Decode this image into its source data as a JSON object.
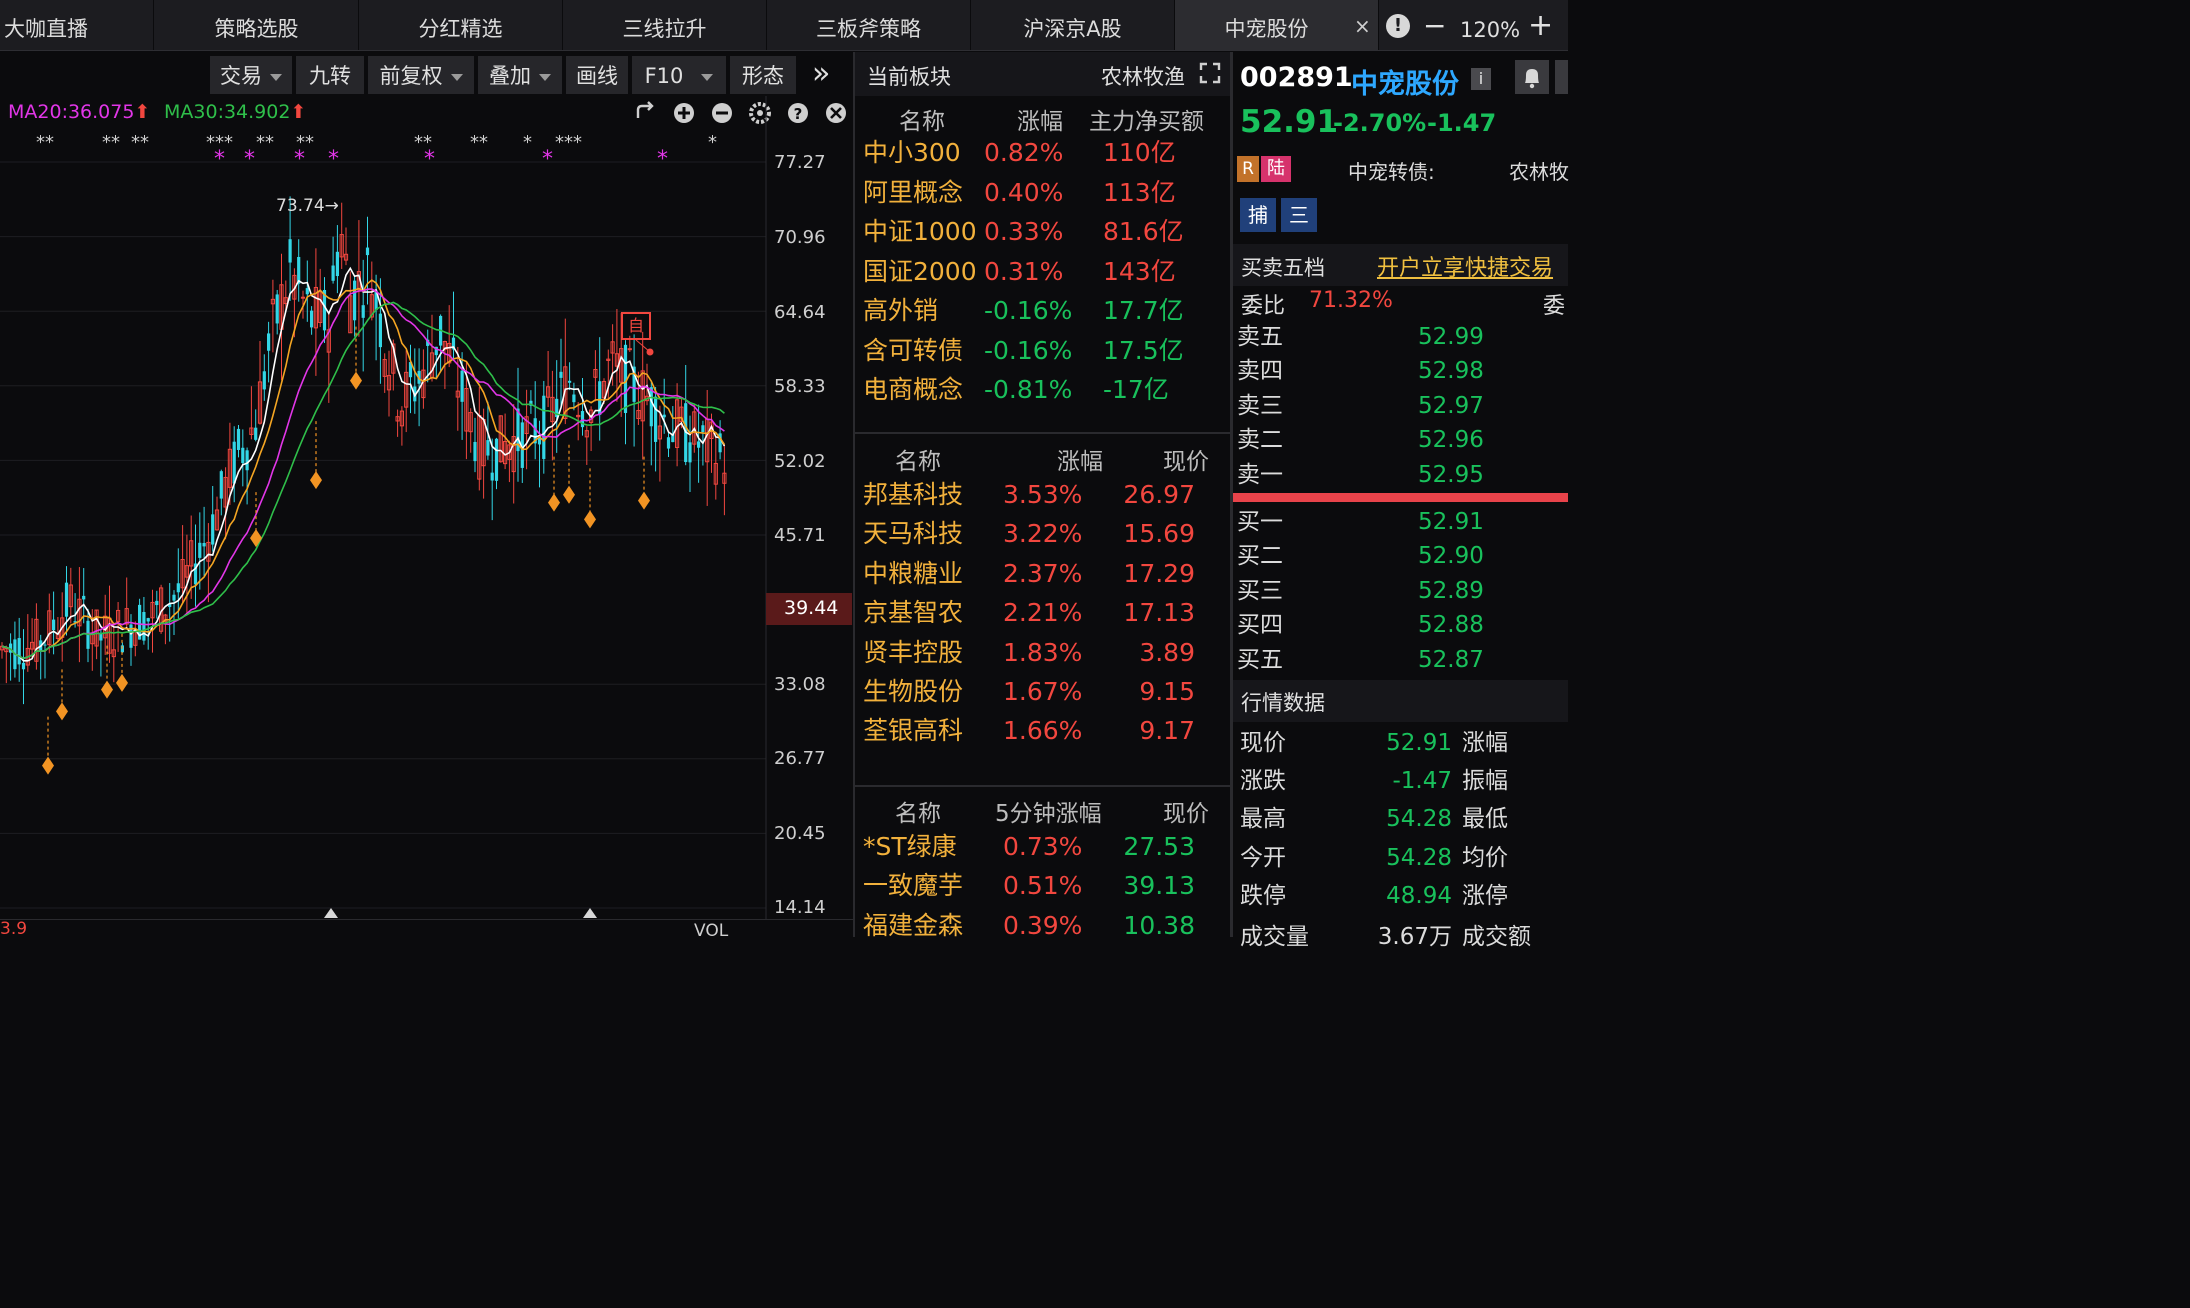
{
  "tabs": [
    {
      "label": "大咖直播"
    },
    {
      "label": "策略选股"
    },
    {
      "label": "分红精选"
    },
    {
      "label": "三线拉升"
    },
    {
      "label": "三板斧策略"
    },
    {
      "label": "沪深京A股"
    },
    {
      "label": "中宠股份",
      "active": true
    }
  ],
  "window_controls": {
    "close": "×",
    "info": "!",
    "minus": "−",
    "zoom": "120%",
    "plus": "+"
  },
  "toolbar": {
    "trade": "交易",
    "nine": "九转",
    "adjust": "前复权",
    "overlay": "叠加",
    "draw": "画线",
    "f10": "F10",
    "shape": "形态",
    "more": "»"
  },
  "chart": {
    "ma20_label": "MA20:36.075",
    "ma30_label": "MA30:34.902",
    "peak_label": "73.74",
    "self_marker": "自",
    "price_ticks": [
      "77.27",
      "70.96",
      "64.64",
      "58.33",
      "52.02",
      "45.71",
      "39.44",
      "33.08",
      "26.77",
      "20.45",
      "14.14"
    ],
    "current_price_tag": "39.44",
    "vol_label": "VOL",
    "bottom_left_label": "3.9",
    "colors": {
      "up": "#f2473f",
      "down": "#33d6e6",
      "ma5": "#ffffff",
      "ma10": "#f5a623",
      "ma20": "#e236e8",
      "ma30": "#2fbf4a",
      "signal": "#f29423"
    }
  },
  "chart_data": {
    "type": "candlestick",
    "yticks": [
      77.27,
      70.96,
      64.64,
      58.33,
      52.02,
      45.71,
      39.44,
      33.08,
      26.77,
      20.45,
      14.14
    ],
    "peak": 73.74,
    "last_close": 52.91,
    "ma20": 36.075,
    "ma30": 34.902
  },
  "sector_panel": {
    "title": "当前板块",
    "current": "农林牧渔",
    "headers": [
      "名称",
      "涨幅",
      "主力净买额"
    ],
    "rows": [
      {
        "name": "中小300",
        "pct": "0.82%",
        "amt": "110亿",
        "up": true
      },
      {
        "name": "阿里概念",
        "pct": "0.40%",
        "amt": "113亿",
        "up": true
      },
      {
        "name": "中证1000",
        "pct": "0.33%",
        "amt": "81.6亿",
        "up": true
      },
      {
        "name": "国证2000",
        "pct": "0.31%",
        "amt": "143亿",
        "up": true
      },
      {
        "name": "高外销",
        "pct": "-0.16%",
        "amt": "17.7亿",
        "up": false
      },
      {
        "name": "含可转债",
        "pct": "-0.16%",
        "amt": "17.5亿",
        "up": false
      },
      {
        "name": "电商概念",
        "pct": "-0.81%",
        "amt": "-17亿",
        "up": false
      }
    ]
  },
  "stocks_panel": {
    "headers": [
      "名称",
      "涨幅",
      "现价"
    ],
    "rows": [
      {
        "name": "邦基科技",
        "pct": "3.53%",
        "price": "26.97"
      },
      {
        "name": "天马科技",
        "pct": "3.22%",
        "price": "15.69"
      },
      {
        "name": "中粮糖业",
        "pct": "2.37%",
        "price": "17.29"
      },
      {
        "name": "京基智农",
        "pct": "2.21%",
        "price": "17.13"
      },
      {
        "name": "贤丰控股",
        "pct": "1.83%",
        "price": "3.89"
      },
      {
        "name": "生物股份",
        "pct": "1.67%",
        "price": "9.15"
      },
      {
        "name": "荃银高科",
        "pct": "1.66%",
        "price": "9.17"
      }
    ]
  },
  "speed_panel": {
    "headers": [
      "名称",
      "5分钟涨幅",
      "现价"
    ],
    "rows": [
      {
        "name": "*ST绿康",
        "pct": "0.73%",
        "price": "27.53"
      },
      {
        "name": "一致魔芋",
        "pct": "0.51%",
        "price": "39.13"
      },
      {
        "name": "福建金森",
        "pct": "0.39%",
        "price": "10.38"
      }
    ]
  },
  "quote": {
    "code": "002891",
    "name": "中宠股份",
    "info_icon": "i",
    "price": "52.91",
    "pct": "-2.70%",
    "chg": "-1.47",
    "badge_r": "R",
    "badge_lu": "陆",
    "convert_bond_label": "中宠转债:",
    "sector_short": "农林牧",
    "btn_catch": "捕",
    "btn_three": "三",
    "five_label": "买卖五档",
    "open_account": "开户立享快捷交易",
    "weibi_label": "委比",
    "weibi_val": "71.32%",
    "wei_short": "委",
    "sells": [
      {
        "label": "卖五",
        "price": "52.99"
      },
      {
        "label": "卖四",
        "price": "52.98"
      },
      {
        "label": "卖三",
        "price": "52.97"
      },
      {
        "label": "卖二",
        "price": "52.96"
      },
      {
        "label": "卖一",
        "price": "52.95"
      }
    ],
    "buys": [
      {
        "label": "买一",
        "price": "52.91"
      },
      {
        "label": "买二",
        "price": "52.90"
      },
      {
        "label": "买三",
        "price": "52.89"
      },
      {
        "label": "买四",
        "price": "52.88"
      },
      {
        "label": "买五",
        "price": "52.87"
      }
    ],
    "market_title": "行情数据",
    "market_rows": [
      {
        "label": "现价",
        "val": "52.91",
        "label2": "涨幅"
      },
      {
        "label": "涨跌",
        "val": "-1.47",
        "label2": "振幅"
      },
      {
        "label": "最高",
        "val": "54.28",
        "label2": "最低"
      },
      {
        "label": "今开",
        "val": "54.28",
        "label2": "均价"
      },
      {
        "label": "跌停",
        "val": "48.94",
        "label2": "涨停"
      }
    ],
    "partial_row": {
      "label": "成交量",
      "val": "3.67万",
      "label2": "成交额"
    }
  }
}
